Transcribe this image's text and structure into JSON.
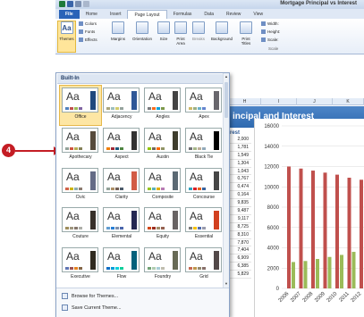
{
  "window": {
    "title": "Mortgage Principal vs Interest"
  },
  "tabs": [
    "File",
    "Home",
    "Insert",
    "Page Layout",
    "Formulas",
    "Data",
    "Review",
    "View"
  ],
  "ribbon": {
    "themes_label": "Themes",
    "colors_label": "Colors",
    "fonts_label": "Fonts",
    "effects_label": "Effects",
    "margins_label": "Margins",
    "orientation_label": "Orientation",
    "size_label": "Size",
    "print_area_label": "Print Area",
    "breaks_label": "Breaks",
    "background_label": "Background",
    "print_titles_label": "Print Titles",
    "width_label": "Width:",
    "height_label": "Height:",
    "scale_label": "Scale:",
    "scale_group_label": "Scale"
  },
  "dropdown": {
    "section_header": "Built-In",
    "themes": [
      {
        "name": "Office",
        "selected": true,
        "colors": [
          "#4f81bd",
          "#c0504d",
          "#9bbb59",
          "#8064a2"
        ],
        "side": "#1f497d"
      },
      {
        "name": "Adjacency",
        "selected": false,
        "colors": [
          "#a9a57c",
          "#9cbebd",
          "#d2cb6c",
          "#95a39d"
        ],
        "side": "#2f5897"
      },
      {
        "name": "Angles",
        "selected": false,
        "colors": [
          "#797b7e",
          "#f96a1b",
          "#08a1d9",
          "#7c984a"
        ],
        "side": "#434343"
      },
      {
        "name": "Apex",
        "selected": false,
        "colors": [
          "#ceb966",
          "#9cb084",
          "#6bb1c9",
          "#6585cf"
        ],
        "side": "#69676d"
      },
      {
        "name": "Apothecary",
        "selected": false,
        "colors": [
          "#93a299",
          "#cf543f",
          "#b5ae53",
          "#848058"
        ],
        "side": "#564b3c"
      },
      {
        "name": "Aspect",
        "selected": false,
        "colors": [
          "#f07f09",
          "#9f2936",
          "#1b587c",
          "#4e8542"
        ],
        "side": "#323232"
      },
      {
        "name": "Austin",
        "selected": false,
        "colors": [
          "#94c600",
          "#71685a",
          "#ff6700",
          "#909465"
        ],
        "side": "#3e3d2d"
      },
      {
        "name": "Black Tie",
        "selected": false,
        "colors": [
          "#6f6f74",
          "#a7b789",
          "#beae98",
          "#92a9b9"
        ],
        "side": "#000000"
      },
      {
        "name": "Civic",
        "selected": false,
        "colors": [
          "#d16349",
          "#ccb400",
          "#8cadae",
          "#8c7b70"
        ],
        "side": "#646b86"
      },
      {
        "name": "Clarity",
        "selected": false,
        "colors": [
          "#93a299",
          "#ad8f67",
          "#726056",
          "#4c5a6a"
        ],
        "side": "#d25c46"
      },
      {
        "name": "Composite",
        "selected": false,
        "colors": [
          "#98c723",
          "#59b0b9",
          "#deae00",
          "#b77bb4"
        ],
        "side": "#5b6973"
      },
      {
        "name": "Concourse",
        "selected": false,
        "colors": [
          "#2da2bf",
          "#da1f28",
          "#eb641b",
          "#39639d"
        ],
        "side": "#464646"
      },
      {
        "name": "Couture",
        "selected": false,
        "colors": [
          "#9e8e5c",
          "#a09781",
          "#85776d",
          "#aeafa9"
        ],
        "side": "#37302a"
      },
      {
        "name": "Elemental",
        "selected": false,
        "colors": [
          "#629dd1",
          "#297fd5",
          "#7f8fa9",
          "#4a66ac"
        ],
        "side": "#242852"
      },
      {
        "name": "Equity",
        "selected": false,
        "colors": [
          "#d34817",
          "#9b2d1f",
          "#a28e6a",
          "#956251"
        ],
        "side": "#696464"
      },
      {
        "name": "Essential",
        "selected": false,
        "colors": [
          "#7a7a7a",
          "#f5c201",
          "#526db0",
          "#989aac"
        ],
        "side": "#d2401f"
      },
      {
        "name": "Executive",
        "selected": false,
        "colors": [
          "#6076b4",
          "#9c5252",
          "#e68422",
          "#846648"
        ],
        "side": "#2f2b20"
      },
      {
        "name": "Flow",
        "selected": false,
        "colors": [
          "#0f6fc6",
          "#009dd9",
          "#0bd0d9",
          "#10cf9b"
        ],
        "side": "#04617b"
      },
      {
        "name": "Foundry",
        "selected": false,
        "colors": [
          "#72a376",
          "#b0ccb0",
          "#a8cdd7",
          "#c0beaf"
        ],
        "side": "#676a55"
      },
      {
        "name": "Grid",
        "selected": false,
        "colors": [
          "#c66951",
          "#bf974d",
          "#928b70",
          "#87706b"
        ],
        "side": "#534949"
      }
    ],
    "browse_label": "Browse for Themes...",
    "save_label": "Save Current Theme..."
  },
  "sheet": {
    "columns": [
      "H",
      "I",
      "J",
      "K"
    ],
    "banner_title": "incipal and Interest",
    "est_label": "rest",
    "values": [
      "2,000",
      "1,781",
      "1,549",
      "1,304",
      "1,043",
      "0,767",
      "0,474",
      "0,164",
      "9,835",
      "9,487",
      "9,117",
      "8,725",
      "8,310",
      "7,870",
      "7,404",
      "6,909",
      "6,385",
      "5,829"
    ]
  },
  "chart_data": {
    "type": "bar",
    "ylim": [
      0,
      16000
    ],
    "yticks": [
      0,
      2000,
      4000,
      6000,
      8000,
      10000,
      12000,
      14000,
      16000
    ],
    "categories": [
      "2006",
      "2007",
      "2008",
      "2009",
      "2010",
      "2011",
      "2012"
    ],
    "series": [
      {
        "color": "#c0504d",
        "values": [
          12000,
          11800,
          11600,
          11400,
          11200,
          10900,
          10700
        ]
      },
      {
        "color": "#9bbb59",
        "values": [
          2600,
          2700,
          2900,
          3100,
          3300,
          3600,
          3800
        ]
      }
    ]
  },
  "callout": {
    "step": "4"
  }
}
